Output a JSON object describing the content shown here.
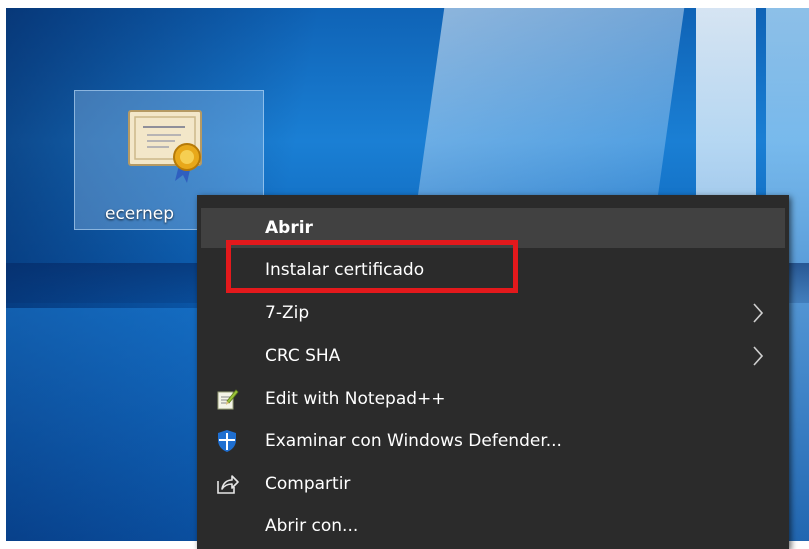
{
  "desktop": {
    "icon": {
      "label": "ecernep",
      "icon_name": "certificate-icon"
    }
  },
  "context_menu": {
    "items": [
      {
        "label": "Abrir",
        "bold": true,
        "highlighted": true
      },
      {
        "label": "Instalar certificado"
      },
      {
        "label": "7-Zip",
        "submenu": true
      },
      {
        "label": "CRC SHA",
        "submenu": true
      },
      {
        "label": "Edit with Notepad++",
        "icon": "notepad-plus-plus-icon"
      },
      {
        "label": "Examinar con Windows Defender...",
        "icon": "windows-defender-shield-icon"
      },
      {
        "label": "Compartir",
        "icon": "share-icon"
      },
      {
        "label": "Abrir con..."
      }
    ]
  },
  "annotation": {
    "highlight_color": "#e3191c"
  },
  "colors": {
    "menu_background": "#2b2b2b",
    "menu_hover": "#414141",
    "menu_text": "#ffffff",
    "desktop_blue": "#0f63b6"
  }
}
